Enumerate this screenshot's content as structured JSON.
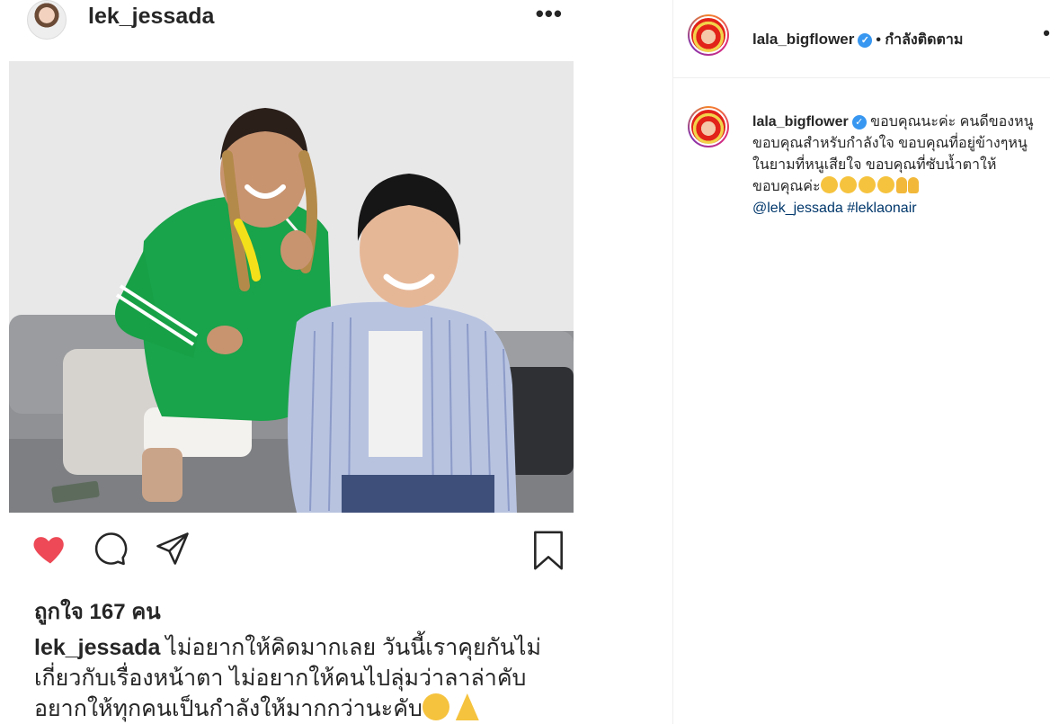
{
  "post": {
    "author": "lek_jessada",
    "more": "•••",
    "likes": "ถูกใจ 167 คน",
    "caption_user": "lek_jessada",
    "caption_text": "ไม่อยากให้คิดมากเลย วันนี้เราคุยกันไม่เกี่ยวกับเรื่องหน้าตา ไม่อยากให้คนไปลุ่มว่าลาล่าคับ อยากให้ทุกคนเป็นกำลังให้มากกว่านะคับ",
    "liked": true
  },
  "panel": {
    "username": "lala_bigflower",
    "following": "• กำลังติดตาม",
    "more": "•",
    "comment_user": "lala_bigflower",
    "comment_text": "ขอบคุณนะค่ะ คนดีของหนู ขอบคุณสำหรับกำลังใจ ขอบคุณที่อยู่ข้างๆหนูในยามที่หนูเสียใจ ขอบคุณที่ซับน้ำตาให้ ขอบคุณค่ะ",
    "mention": "@lek_jessada",
    "hashtag": "#leklaonair"
  },
  "colors": {
    "like_red": "#ed4956",
    "verified_blue": "#3897f0",
    "link_blue": "#00376b"
  },
  "icons": [
    "heart-icon",
    "comment-icon",
    "share-icon",
    "bookmark-icon",
    "verified-icon"
  ]
}
